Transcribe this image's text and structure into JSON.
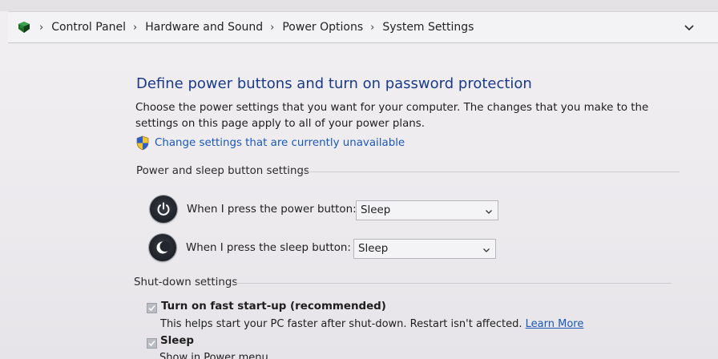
{
  "breadcrumb": {
    "items": [
      "Control Panel",
      "Hardware and Sound",
      "Power Options",
      "System Settings"
    ]
  },
  "main": {
    "title": "Define power buttons and turn on password protection",
    "description": "Choose the power settings that you want for your computer. The changes that you make to the settings on this page apply to all of your power plans.",
    "change_link": "Change settings that are currently unavailable",
    "power_section": {
      "heading": "Power and sleep button settings",
      "rows": [
        {
          "label": "When I press the power button:",
          "value": "Sleep"
        },
        {
          "label": "When I press the sleep button:",
          "value": "Sleep"
        }
      ]
    },
    "shutdown_section": {
      "heading": "Shut-down settings",
      "options": [
        {
          "label": "Turn on fast start-up (recommended)",
          "checked": true,
          "description": "This helps start your PC faster after shut-down. Restart isn't affected.",
          "link": "Learn More"
        },
        {
          "label": "Sleep",
          "checked": true,
          "description": "Show in Power menu"
        }
      ]
    }
  },
  "icons": {
    "control_panel": "control-panel-icon",
    "shield": "uac-shield-icon",
    "power": "power-icon",
    "sleep": "sleep-moon-icon"
  },
  "colors": {
    "title": "#1c3a8a",
    "link": "#1b58b8",
    "background": "#eceaec"
  }
}
